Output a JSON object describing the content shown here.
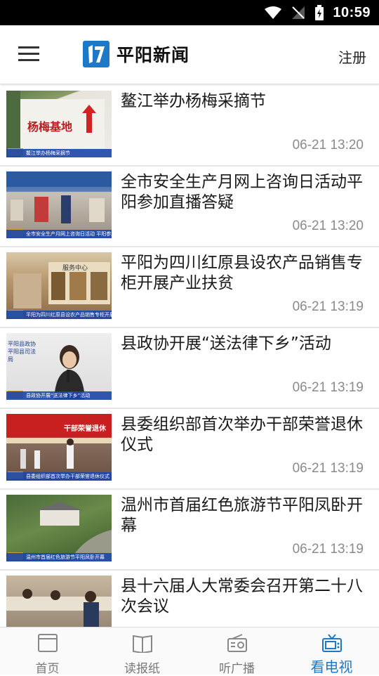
{
  "statusbar": {
    "time": "10:59"
  },
  "appbar": {
    "title": "平阳新闻",
    "register": "注册"
  },
  "news": [
    {
      "title": "鳌江举办杨梅采摘节",
      "time": "06-21 13:20",
      "caption": "鳌江举办杨梅采摘节",
      "sign": "杨梅基地"
    },
    {
      "title": "全市安全生产月网上咨询日活动平阳参加直播答疑",
      "time": "06-21 13:20",
      "caption": "全市安全生产月网上咨询日活动 平阳参加直播答疑"
    },
    {
      "title": "平阳为四川红原县设农产品销售专柜开展产业扶贫",
      "time": "06-21 13:19",
      "caption": "平阳为四川红原县设农产品销售专柜开展产业扶贫",
      "sign": "服务中心"
    },
    {
      "title": "县政协开展“送法律下乡”活动",
      "time": "06-21 13:19",
      "caption": "县政协开展“送法律下乡”活动",
      "sign": "平阳县政协 平阳县司法局"
    },
    {
      "title": "县委组织部首次举办干部荣誉退休仪式",
      "time": "06-21 13:19",
      "caption": "县委组织部首次举办干部荣誉退休仪式",
      "sign": "干部荣誉退休"
    },
    {
      "title": "温州市首届红色旅游节平阳凤卧开幕",
      "time": "06-21 13:19",
      "caption": "温州市首届红色旅游节平阳凤卧开幕"
    },
    {
      "title": "县十六届人大常委会召开第二十八次会议",
      "time": "",
      "caption": ""
    }
  ],
  "tabs": [
    {
      "label": "首页",
      "icon": "home-icon"
    },
    {
      "label": "读报纸",
      "icon": "book-icon"
    },
    {
      "label": "听广播",
      "icon": "radio-icon"
    },
    {
      "label": "看电视",
      "icon": "tv-icon",
      "active": true
    }
  ],
  "colors": {
    "accent": "#1d78c8",
    "divider": "#e6e6e6"
  }
}
